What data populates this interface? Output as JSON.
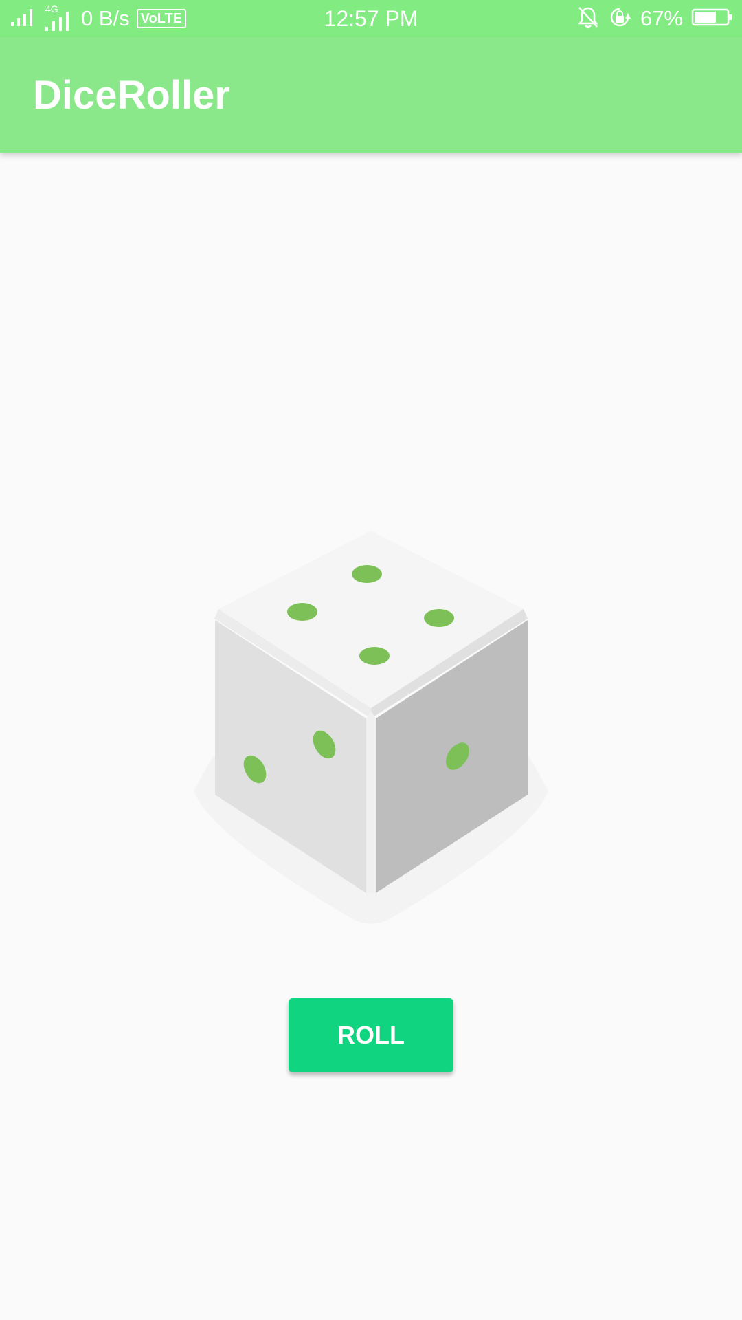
{
  "status_bar": {
    "signal_label": "4G",
    "data_rate": "0 B/s",
    "volte": "VoLTE",
    "time": "12:57 PM",
    "battery_percent": "67%",
    "battery_level": 0.67,
    "icons": [
      "signal-icon",
      "signal-4g-icon",
      "notification-muted-icon",
      "rotation-lock-icon",
      "battery-icon"
    ]
  },
  "app_bar": {
    "title": "DiceRoller"
  },
  "dice": {
    "top_face_pips": 4,
    "left_face_pips": 2,
    "right_face_pips": 1,
    "pip_color": "#7cc057"
  },
  "main": {
    "roll_button_label": "ROLL"
  },
  "colors": {
    "status_bar": "#82ec82",
    "app_bar": "#8ae88a",
    "button": "#10d47f",
    "background": "#fafafa"
  }
}
